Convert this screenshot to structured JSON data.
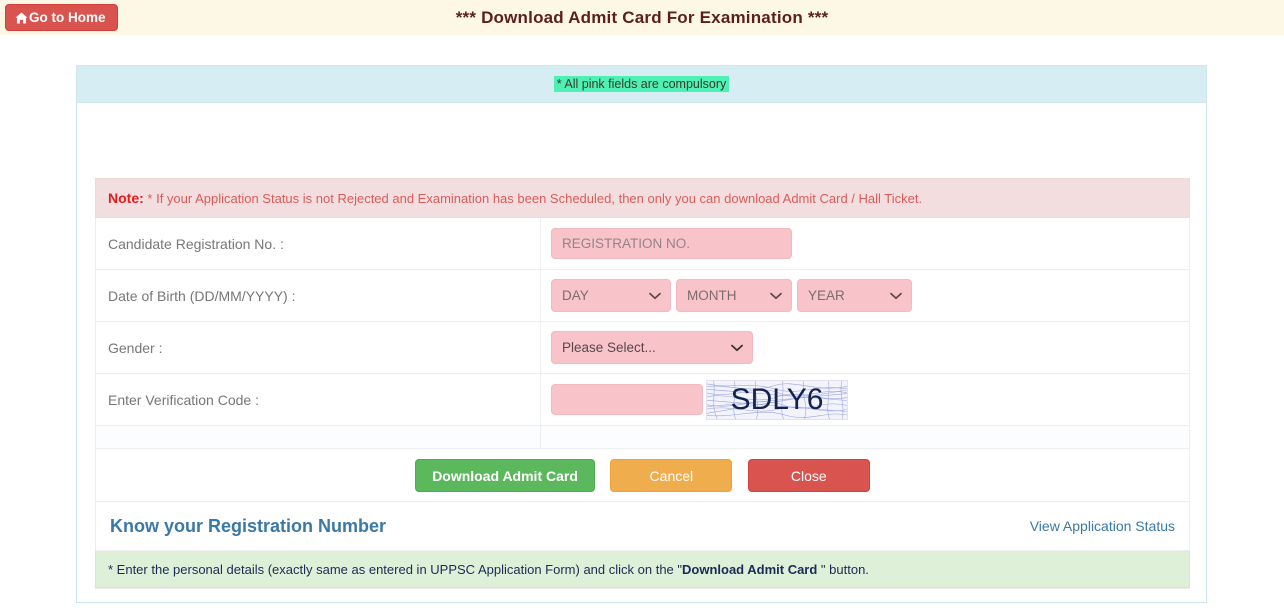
{
  "topbar": {
    "home_button_label": "Go to Home",
    "home_icon": "home-icon",
    "title": "*** Download Admit Card For Examination ***"
  },
  "panel": {
    "compulsory_note": "* All pink fields are compulsory"
  },
  "note": {
    "prefix": "Note:",
    "text": "* If your Application Status is not Rejected and Examination has been Scheduled, then only you can download Admit Card / Hall Ticket."
  },
  "form": {
    "registration": {
      "label": "Candidate Registration No. :",
      "placeholder": "REGISTRATION NO.",
      "value": ""
    },
    "dob": {
      "label": "Date of Birth (DD/MM/YYYY) :",
      "day": {
        "selected": "DAY",
        "options": [
          "DAY"
        ]
      },
      "month": {
        "selected": "MONTH",
        "options": [
          "MONTH"
        ]
      },
      "year": {
        "selected": "YEAR",
        "options": [
          "YEAR"
        ]
      }
    },
    "gender": {
      "label": "Gender :",
      "selected": "Please Select...",
      "options": [
        "Please Select..."
      ]
    },
    "verification": {
      "label": "Enter Verification Code :",
      "placeholder": "",
      "value": "",
      "captcha_text": "SDLY6"
    }
  },
  "buttons": {
    "download": "Download Admit Card",
    "cancel": "Cancel",
    "close": "Close"
  },
  "links": {
    "know_registration": "Know your Registration Number",
    "view_status": "View Application Status"
  },
  "footer": {
    "text_before": "* Enter the personal details (exactly same as entered in UPPSC Application Form) and click on the \"",
    "bold": "Download Admit Card",
    "text_after": " \" button."
  },
  "colors": {
    "header_bg": "#fdf8e6",
    "header_text": "#5b1f1f",
    "panel_head_bg": "#d6edf4",
    "compulsory_highlight": "#4ef0b4",
    "pink_field": "#f9c4c9",
    "note_bg": "#f2dede",
    "note_text": "#e05a5a",
    "footer_bg": "#dff0d8",
    "link": "#3a78a8",
    "btn_green": "#5cb85c",
    "btn_orange": "#f0ad4e",
    "btn_red": "#d9534f"
  }
}
